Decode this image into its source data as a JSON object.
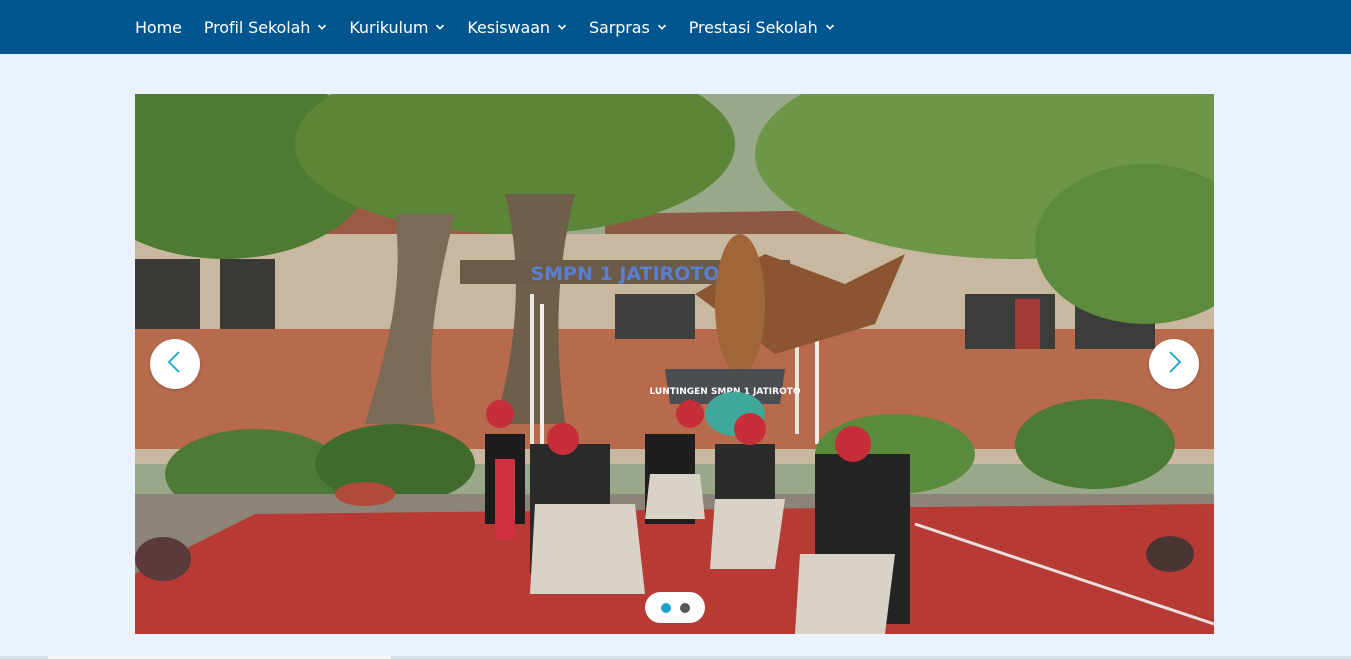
{
  "nav": {
    "items": [
      {
        "label": "Home",
        "has_dropdown": false
      },
      {
        "label": "Profil Sekolah",
        "has_dropdown": true
      },
      {
        "label": "Kurikulum",
        "has_dropdown": true
      },
      {
        "label": "Kesiswaan",
        "has_dropdown": true
      },
      {
        "label": "Sarpras",
        "has_dropdown": true
      },
      {
        "label": "Prestasi Sekolah",
        "has_dropdown": true
      }
    ]
  },
  "slider": {
    "slide_sign_text": "SMPN 1 JATIROTO",
    "slide_small_sign_text": "LUNTINGEN SMPN 1 JATIROTO",
    "prev_icon": "chevron-left-icon",
    "next_icon": "chevron-right-icon",
    "dot_count": 2,
    "active_dot": 1
  },
  "colors": {
    "nav_bg": "#02568f",
    "page_bg": "#eaf3fd",
    "accent": "#1aa3c9"
  }
}
